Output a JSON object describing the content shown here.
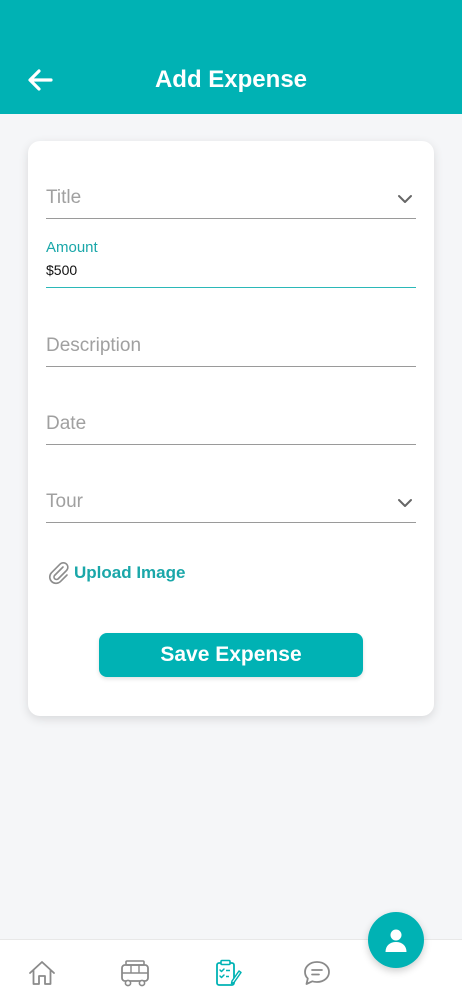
{
  "header": {
    "title": "Add Expense",
    "color": "#00b2b4"
  },
  "form": {
    "title_placeholder": "Title",
    "amount_label": "Amount",
    "amount_value": "$500",
    "description_placeholder": "Description",
    "date_placeholder": "Date",
    "tour_placeholder": "Tour",
    "upload_label": "Upload Image",
    "save_label": "Save Expense"
  },
  "bottom_nav": {
    "items": [
      {
        "icon": "home-icon",
        "active": false
      },
      {
        "icon": "bus-icon",
        "active": false
      },
      {
        "icon": "expense-report-icon",
        "active": true
      },
      {
        "icon": "chat-icon",
        "active": false
      }
    ]
  },
  "fab": {
    "icon": "user-icon"
  },
  "colors": {
    "accent": "#00b2b4",
    "accent_text": "#1aa7a9",
    "nav_inactive": "#8a8a8a"
  }
}
